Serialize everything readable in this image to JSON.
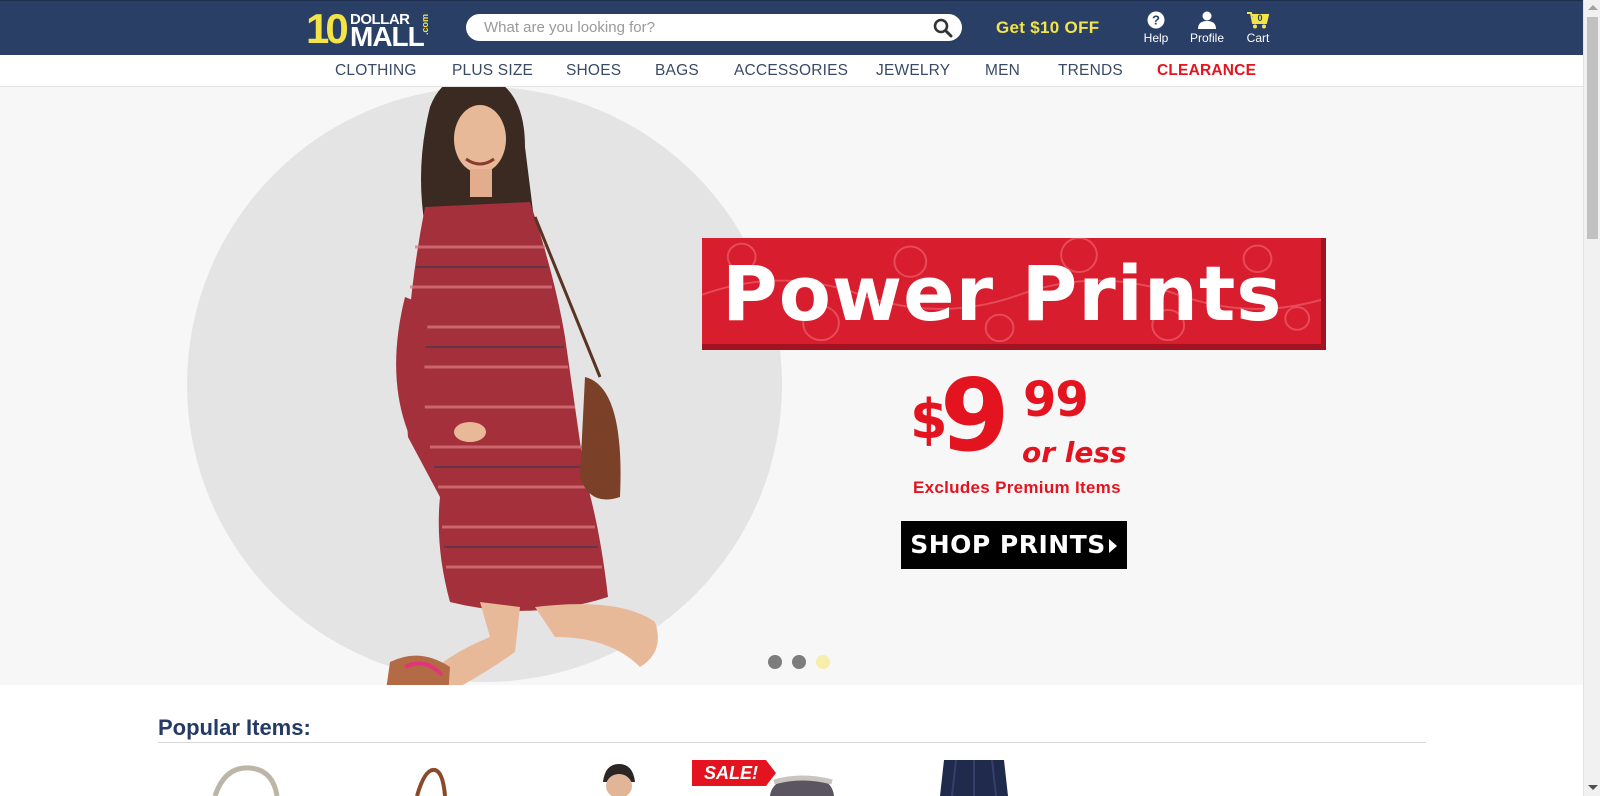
{
  "header": {
    "logo": {
      "ten": "10",
      "dollar": "DOLLAR",
      "mall": "MALL",
      "com": ".com"
    },
    "search": {
      "placeholder": "What are you looking for?",
      "value": "",
      "icon": "search-icon"
    },
    "promo_label": "Get $10 OFF",
    "actions": [
      {
        "label": "Help",
        "icon": "help-icon"
      },
      {
        "label": "Profile",
        "icon": "profile-icon"
      },
      {
        "label": "Cart",
        "icon": "cart-icon",
        "count": "0"
      }
    ],
    "colors": {
      "bar": "#2a3f66",
      "accent": "#f3e447"
    }
  },
  "nav": {
    "items": [
      "CLOTHING",
      "PLUS SIZE",
      "SHOES",
      "BAGS",
      "ACCESSORIES",
      "JEWELRY",
      "MEN",
      "TRENDS",
      "CLEARANCE"
    ],
    "highlight_color": "#e3141f"
  },
  "hero": {
    "title": "Power Prints",
    "price": {
      "currency": "$",
      "dollars": "9",
      "cents": "99",
      "suffix": "or less"
    },
    "note": "Excludes Premium Items",
    "cta": "SHOP PRINTS",
    "slides": {
      "count": 3,
      "active": 3
    },
    "brand_red": "#e3141f"
  },
  "popular": {
    "title": "Popular Items:",
    "sale_badge": "SALE!"
  }
}
